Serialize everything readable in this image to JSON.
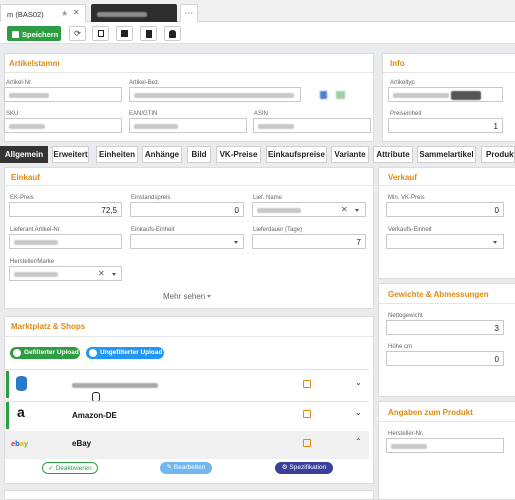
{
  "window_tabs": {
    "current_label": "m (BAS02)",
    "more_label": "···"
  },
  "toolbar": {
    "save_label": "Speichern",
    "refresh_icon": "⟳"
  },
  "artikelstamm": {
    "title": "Artikelstamm",
    "artikel_nr_label": "Artikel-Nr.",
    "artikel_bez_label": "Artikel-Bez.",
    "sku_label": "SKU",
    "ean_label": "EAN/GTIN",
    "asin_label": "ASIN"
  },
  "info": {
    "title": "Info",
    "artikeltyp_label": "Artikeltyp",
    "preiseinheit_label": "Preiseinheit",
    "preiseinheit_value": "1"
  },
  "tabs": [
    "Allgemein",
    "Erweitert",
    "Einheiten",
    "Anhänge",
    "Bild",
    "VK-Preise",
    "Einkaufspreise",
    "Variante",
    "Attribute",
    "Sammelartikel",
    "Produkti"
  ],
  "einkauf": {
    "title": "Einkauf",
    "ek_preis_label": "EK-Preis",
    "ek_preis_value": "72,5",
    "einstandspreis_label": "Einstandspreis",
    "einstandspreis_value": "0",
    "lief_name_label": "Lief. Name",
    "lief_artikel_label": "Lieferant Artikel-Nr.",
    "einkaufs_einheit_label": "Einkaufs-Einheit",
    "lieferdauer_label": "Lieferdauer (Tage)",
    "lieferdauer_value": "7",
    "hersteller_label": "Hersteller/Marke",
    "mehr_sehen": "Mehr sehen"
  },
  "verkauf": {
    "title": "Verkauf",
    "min_vk_label": "Min. VK-Preis",
    "min_vk_value": "0",
    "verkaufs_einheit_label": "Verkaufs-Einheit"
  },
  "gewichte": {
    "title": "Gewichte & Abmessungen",
    "netto_label": "Nettogewicht",
    "netto_value": "3",
    "hoehe_label": "Höhe cm",
    "hoehe_value": "0"
  },
  "angaben": {
    "title": "Angaben zum Produkt",
    "hersteller_nr_label": "Hersteller-Nr."
  },
  "marktplatz": {
    "title": "Marktplatz & Shops",
    "gefiltert_label": "Gefilterter Upload",
    "ungefiltert_label": "Ungefilterter Upload",
    "shops": [
      {
        "name": "",
        "logo": "database-icon"
      },
      {
        "name": "Amazon-DE",
        "logo": "a"
      },
      {
        "name": "eBay",
        "logo": "ebay"
      }
    ],
    "deaktivieren_label": "Deaktivieren",
    "bearbeiten_label": "Bearbeiten",
    "spezifikation_label": "Spezifikation"
  },
  "colors": {
    "accent": "#e28a12",
    "green": "#2e9d41",
    "blue": "#2196f3",
    "dark_blue": "#3b3f9c"
  }
}
